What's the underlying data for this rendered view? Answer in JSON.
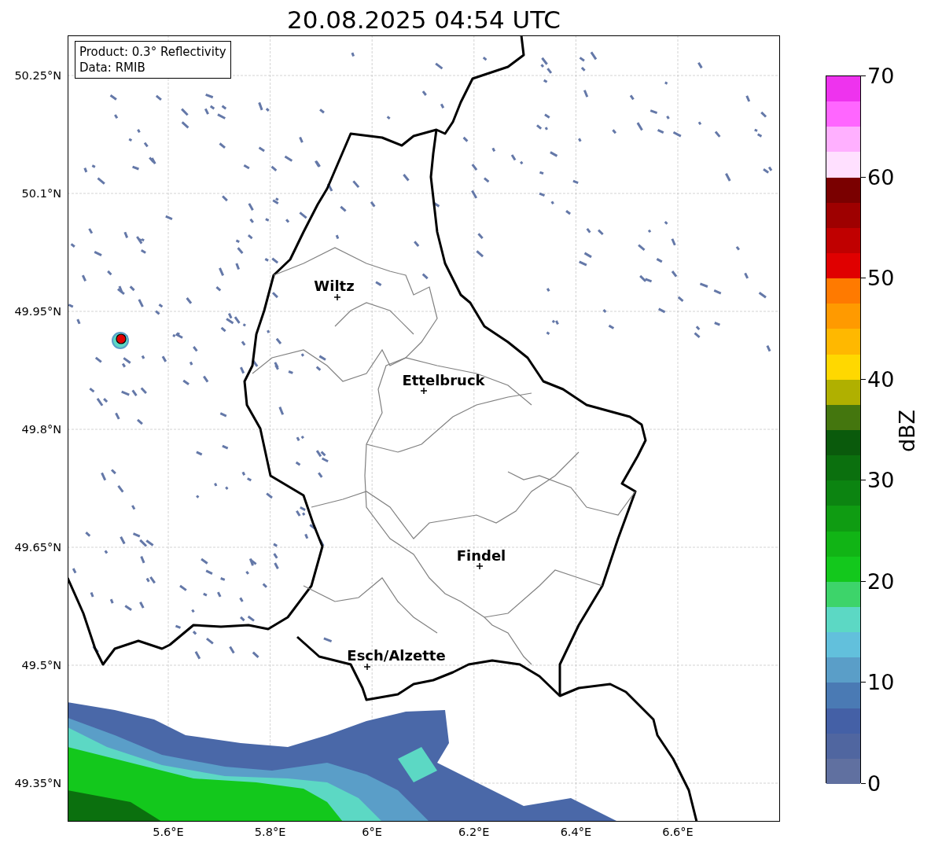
{
  "title": "20.08.2025 04:54 UTC",
  "info_box": {
    "lines": [
      "Product: 0.3° Reflectivity",
      "Data: RMIB"
    ]
  },
  "cities": [
    {
      "name": "Wiltz"
    },
    {
      "name": "Ettelbruck"
    },
    {
      "name": "Findel"
    },
    {
      "name": "Esch/Alzette"
    }
  ],
  "y_axis": {
    "ticks": [
      "50.25°N",
      "50.1°N",
      "49.95°N",
      "49.8°N",
      "49.65°N",
      "49.5°N",
      "49.35°N"
    ]
  },
  "x_axis": {
    "ticks": [
      "5.6°E",
      "5.8°E",
      "6°E",
      "6.2°E",
      "6.4°E",
      "6.6°E"
    ]
  },
  "colorbar": {
    "label": "dBZ",
    "ticks": [
      "70",
      "60",
      "50",
      "40",
      "30",
      "20",
      "10",
      "0"
    ],
    "segments": [
      {
        "color": "#6070a0"
      },
      {
        "color": "#5066a0"
      },
      {
        "color": "#4460a6"
      },
      {
        "color": "#4a7ab4"
      },
      {
        "color": "#5a9ec8"
      },
      {
        "color": "#62c0dc"
      },
      {
        "color": "#5cd8c4"
      },
      {
        "color": "#3dd46a"
      },
      {
        "color": "#13c81c"
      },
      {
        "color": "#11b415"
      },
      {
        "color": "#0f9c12"
      },
      {
        "color": "#0c8411"
      },
      {
        "color": "#0b700e"
      },
      {
        "color": "#0a5a0c"
      },
      {
        "color": "#44760e"
      },
      {
        "color": "#b0b000"
      },
      {
        "color": "#ffd800"
      },
      {
        "color": "#ffb800"
      },
      {
        "color": "#ff9a00"
      },
      {
        "color": "#ff7a00"
      },
      {
        "color": "#e00000"
      },
      {
        "color": "#c00000"
      },
      {
        "color": "#9e0000"
      },
      {
        "color": "#7a0000"
      },
      {
        "color": "#ffe0ff"
      },
      {
        "color": "#ffb0ff"
      },
      {
        "color": "#ff66ff"
      },
      {
        "color": "#ee33ee"
      }
    ]
  }
}
